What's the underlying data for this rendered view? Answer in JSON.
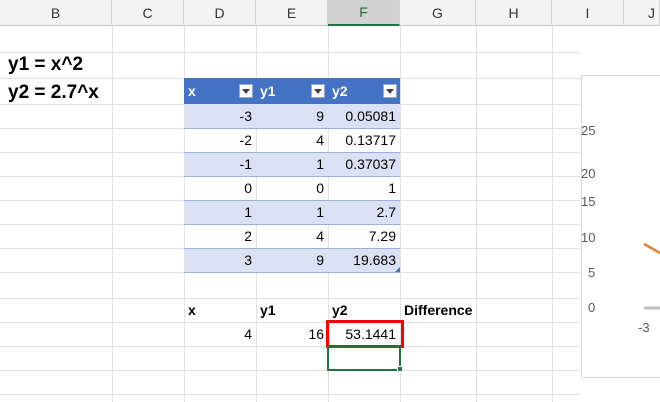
{
  "columns": [
    "B",
    "C",
    "D",
    "E",
    "F",
    "G",
    "H",
    "I",
    "J"
  ],
  "selected_column": "F",
  "equations": {
    "eq1": "y1 = x^2",
    "eq2": "y2 = 2.7^x"
  },
  "table": {
    "headers": [
      "x",
      "y1",
      "y2"
    ],
    "rows": [
      [
        "-3",
        "9",
        "0.05081"
      ],
      [
        "-2",
        "4",
        "0.13717"
      ],
      [
        "-1",
        "1",
        "0.37037"
      ],
      [
        "0",
        "0",
        "1"
      ],
      [
        "1",
        "1",
        "2.7"
      ],
      [
        "2",
        "4",
        "7.29"
      ],
      [
        "3",
        "9",
        "19.683"
      ]
    ]
  },
  "lower": {
    "headers": [
      "x",
      "y1",
      "y2",
      "Difference"
    ],
    "values": [
      "4",
      "16",
      "53.1441"
    ]
  },
  "chart": {
    "y_ticks": [
      "25",
      "20",
      "15",
      "10",
      "5",
      "0"
    ],
    "x_tick": "-3"
  },
  "colors": {
    "table_header": "#4472c4",
    "band": "#d9e1f2",
    "highlight": "#ff0000",
    "selection": "#217346",
    "series": "#ed7d31"
  }
}
